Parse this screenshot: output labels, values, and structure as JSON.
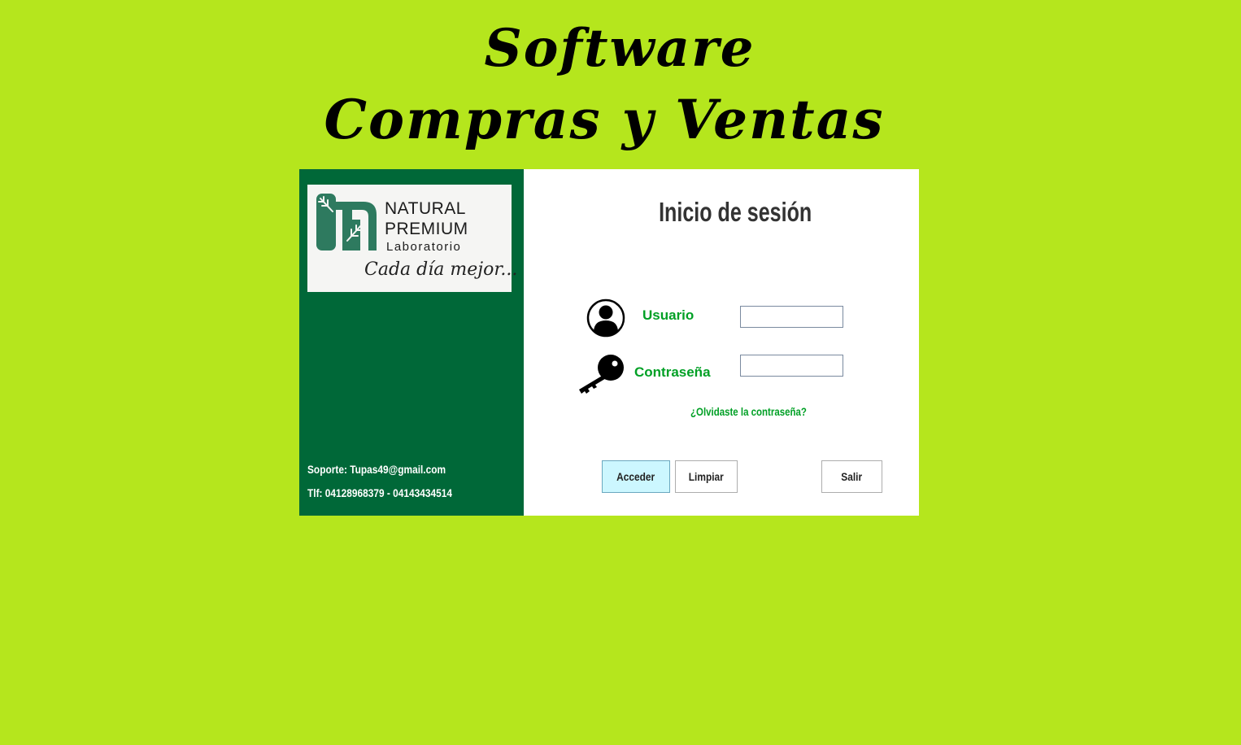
{
  "window": {
    "title_line1": "Software",
    "title_line2": "Compras y Ventas"
  },
  "sidebar": {
    "logo": {
      "line1": "NATURAL",
      "line2": "PREMIUM",
      "line3": "Laboratorio",
      "slogan": "Cada día mejor..."
    },
    "support_email": "Soporte: Tupas49@gmail.com",
    "support_phone": "Tlf: 04128968379 - 04143434514"
  },
  "login": {
    "heading": "Inicio de sesión",
    "user_label": "Usuario",
    "user_value": "",
    "password_label": "Contraseña",
    "password_value": "",
    "forgot_link": "¿Olvidaste la contraseña?"
  },
  "buttons": {
    "login": "Acceder",
    "clear": "Limpiar",
    "exit": "Salir"
  },
  "colors": {
    "background": "#b5e61d",
    "sidebar": "#006838",
    "label_green": "#00a025",
    "accent_button": "#ccf7ff"
  },
  "icons": {
    "user": "user-circle-icon",
    "password": "key-icon",
    "logo": "leaf-logo-icon"
  }
}
